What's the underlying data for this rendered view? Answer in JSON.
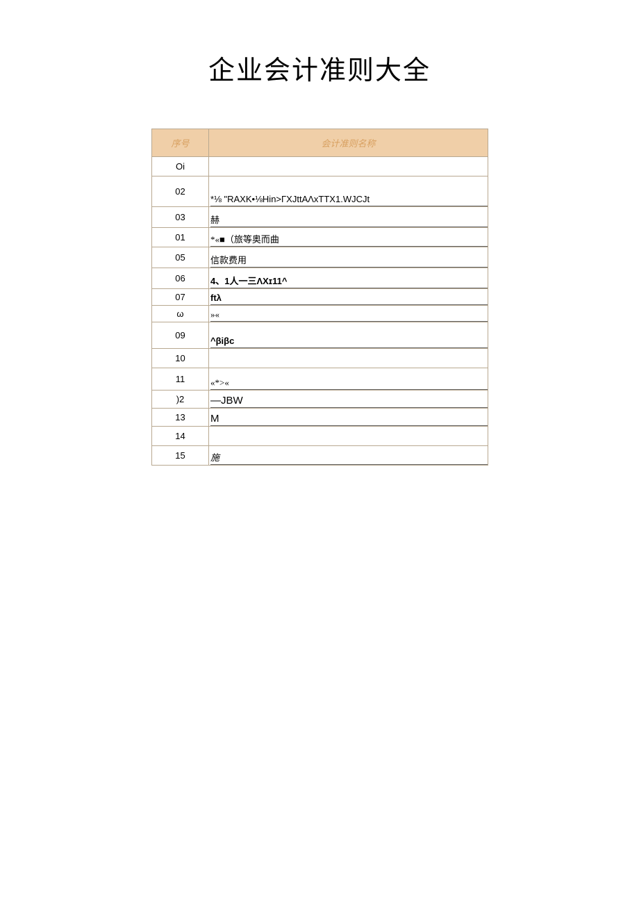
{
  "title": "企业会计准则大全",
  "headers": {
    "seq": "序号",
    "name": "会计准则名称"
  },
  "rows": [
    {
      "seq": "Oi",
      "name": ""
    },
    {
      "seq": "02",
      "name": "*⅛ \"RAXK•⅛Hin>ΓXJttAΛxTTX1.WJCJt"
    },
    {
      "seq": "03",
      "name": "赫"
    },
    {
      "seq": "01",
      "name": "*«■（旅等奥而曲"
    },
    {
      "seq": "05",
      "name": "信款费用"
    },
    {
      "seq": "06",
      "name": "4、1人一三ΛXɪ11^"
    },
    {
      "seq": "07",
      "name": "ftλ"
    },
    {
      "seq": "ω",
      "name": "»«"
    },
    {
      "seq": "09",
      "name": "^βiβc"
    },
    {
      "seq": "10",
      "name": ""
    },
    {
      "seq": "11",
      "name": "«*>«"
    },
    {
      "seq": ")2",
      "name": "—JBW"
    },
    {
      "seq": "13",
      "name": "M"
    },
    {
      "seq": "14",
      "name": ""
    },
    {
      "seq": "15",
      "name": "施"
    }
  ]
}
